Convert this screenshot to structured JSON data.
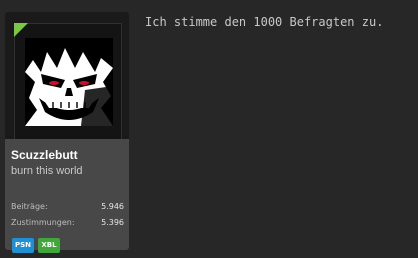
{
  "user": {
    "name": "Scuzzlebutt",
    "title": "burn this world",
    "stats": [
      {
        "label": "Beiträge:",
        "value": "5.946"
      },
      {
        "label": "Zustimmungen:",
        "value": "5.396"
      }
    ],
    "badges": [
      {
        "label": "PSN",
        "color": "#1e90d6"
      },
      {
        "label": "XBL",
        "color": "#41a63b"
      }
    ],
    "avatar_icon": "joker-face-avatar",
    "online_color": "#7ac943"
  },
  "post": {
    "message": "Ich stimme den 1000 Befragten zu."
  },
  "colors": {
    "background": "#272727",
    "card_info": "#484848"
  }
}
